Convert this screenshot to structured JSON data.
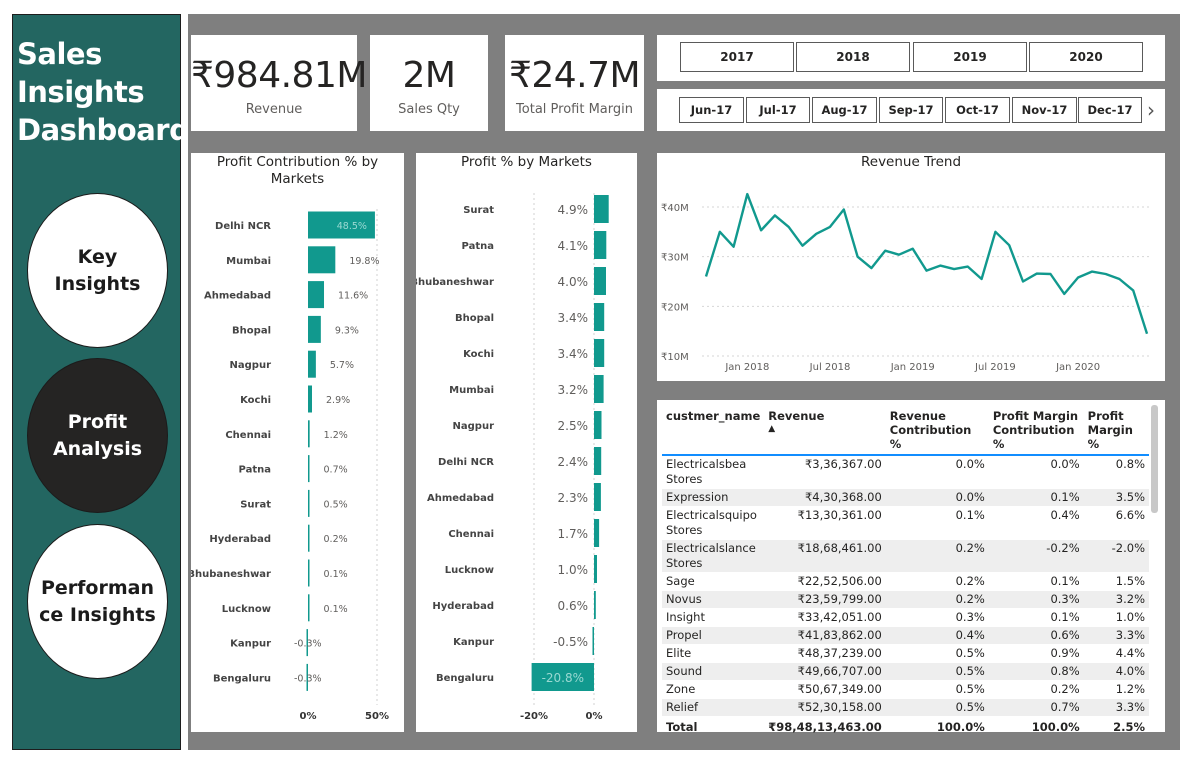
{
  "sidebar": {
    "title_lines": [
      "Sales",
      "Insights",
      "Dashboard"
    ],
    "nav": [
      {
        "label_lines": [
          "Key",
          "Insights"
        ],
        "active": false
      },
      {
        "label_lines": [
          "Profit",
          "Analysis"
        ],
        "active": true
      },
      {
        "label_lines": [
          "Performan",
          "ce Insights"
        ],
        "active": false
      }
    ]
  },
  "kpis": [
    {
      "value": "₹984.81M",
      "label": "Revenue"
    },
    {
      "value": "2M",
      "label": "Sales Qty"
    },
    {
      "value": "₹24.7M",
      "label": "Total Profit Margin"
    }
  ],
  "year_slicer": [
    "2017",
    "2018",
    "2019",
    "2020"
  ],
  "month_slicer": [
    "Jun-17",
    "Jul-17",
    "Aug-17",
    "Sep-17",
    "Oct-17",
    "Nov-17",
    "Dec-17"
  ],
  "chart_data": [
    {
      "type": "bar",
      "orientation": "horizontal",
      "title": "Profit Contribution % by Markets",
      "categories": [
        "Delhi NCR",
        "Mumbai",
        "Ahmedabad",
        "Bhopal",
        "Nagpur",
        "Kochi",
        "Chennai",
        "Patna",
        "Surat",
        "Hyderabad",
        "Bhubaneshwar",
        "Lucknow",
        "Kanpur",
        "Bengaluru"
      ],
      "values": [
        48.5,
        19.8,
        11.6,
        9.3,
        5.7,
        2.9,
        1.2,
        0.7,
        0.5,
        0.2,
        0.1,
        0.1,
        -0.3,
        -0.3
      ],
      "value_labels": [
        "48.5%",
        "19.8%",
        "11.6%",
        "9.3%",
        "5.7%",
        "2.9%",
        "1.2%",
        "0.7%",
        "0.5%",
        "0.2%",
        "0.1%",
        "0.1%",
        "-0.3%",
        "-0.3%"
      ],
      "x_ticks": [
        "0%",
        "50%"
      ],
      "xlim": [
        0,
        50
      ],
      "color": "#11998e"
    },
    {
      "type": "bar",
      "orientation": "horizontal",
      "title": "Profit % by Markets",
      "categories": [
        "Surat",
        "Patna",
        "Bhubaneshwar",
        "Bhopal",
        "Kochi",
        "Mumbai",
        "Nagpur",
        "Delhi NCR",
        "Ahmedabad",
        "Chennai",
        "Lucknow",
        "Hyderabad",
        "Kanpur",
        "Bengaluru"
      ],
      "values": [
        4.9,
        4.1,
        4.0,
        3.4,
        3.4,
        3.2,
        2.5,
        2.4,
        2.3,
        1.7,
        1.0,
        0.6,
        -0.5,
        -20.8
      ],
      "value_labels": [
        "4.9%",
        "4.1%",
        "4.0%",
        "3.4%",
        "3.4%",
        "3.2%",
        "2.5%",
        "2.4%",
        "2.3%",
        "1.7%",
        "1.0%",
        "0.6%",
        "-0.5%",
        "-20.8%"
      ],
      "x_ticks": [
        "-20%",
        "0%"
      ],
      "xlim": [
        -20.8,
        4.9
      ],
      "color": "#11998e"
    },
    {
      "type": "line",
      "title": "Revenue Trend",
      "y_ticks": [
        "₹10M",
        "₹20M",
        "₹30M",
        "₹40M"
      ],
      "ylim": [
        10,
        40
      ],
      "x_ticks": [
        "Jan 2018",
        "Jul 2018",
        "Jan 2019",
        "Jul 2019",
        "Jan 2020"
      ],
      "x": [
        "2017-10",
        "2017-11",
        "2017-12",
        "2018-01",
        "2018-02",
        "2018-03",
        "2018-04",
        "2018-05",
        "2018-06",
        "2018-07",
        "2018-08",
        "2018-09",
        "2018-10",
        "2018-11",
        "2018-12",
        "2019-01",
        "2019-02",
        "2019-03",
        "2019-04",
        "2019-05",
        "2019-06",
        "2019-07",
        "2019-08",
        "2019-09",
        "2019-10",
        "2019-11",
        "2019-12",
        "2020-01",
        "2020-02",
        "2020-03",
        "2020-04",
        "2020-05",
        "2020-06"
      ],
      "y": [
        26.0,
        35.0,
        32.0,
        42.6,
        35.3,
        38.3,
        36.0,
        32.2,
        34.6,
        36.0,
        39.5,
        30.0,
        27.7,
        31.2,
        30.4,
        31.6,
        27.2,
        28.2,
        27.5,
        28.0,
        25.5,
        35.0,
        32.3,
        25.0,
        26.6,
        26.5,
        22.5,
        25.8,
        27.0,
        26.5,
        25.5,
        23.2,
        14.5
      ],
      "grid": true,
      "color": "#11998e"
    }
  ],
  "table": {
    "columns": [
      "custmer_name",
      "Revenue",
      "Revenue Contribution %",
      "Profit Margin Contribution %",
      "Profit Margin %"
    ],
    "rows": [
      [
        "Electricalsbea Stores",
        "₹3,36,367.00",
        "0.0%",
        "0.0%",
        "0.8%"
      ],
      [
        "Expression",
        "₹4,30,368.00",
        "0.0%",
        "0.1%",
        "3.5%"
      ],
      [
        "Electricalsquipo Stores",
        "₹13,30,361.00",
        "0.1%",
        "0.4%",
        "6.6%"
      ],
      [
        "Electricalslance Stores",
        "₹18,68,461.00",
        "0.2%",
        "-0.2%",
        "-2.0%"
      ],
      [
        "Sage",
        "₹22,52,506.00",
        "0.2%",
        "0.1%",
        "1.5%"
      ],
      [
        "Novus",
        "₹23,59,799.00",
        "0.2%",
        "0.3%",
        "3.2%"
      ],
      [
        "Insight",
        "₹33,42,051.00",
        "0.3%",
        "0.1%",
        "1.0%"
      ],
      [
        "Propel",
        "₹41,83,862.00",
        "0.4%",
        "0.6%",
        "3.3%"
      ],
      [
        "Elite",
        "₹48,37,239.00",
        "0.5%",
        "0.9%",
        "4.4%"
      ],
      [
        "Sound",
        "₹49,66,707.00",
        "0.5%",
        "0.8%",
        "4.0%"
      ],
      [
        "Zone",
        "₹50,67,349.00",
        "0.5%",
        "0.2%",
        "1.2%"
      ],
      [
        "Relief",
        "₹52,30,158.00",
        "0.5%",
        "0.7%",
        "3.3%"
      ]
    ],
    "total": [
      "Total",
      "₹98,48,13,463.00",
      "100.0%",
      "100.0%",
      "2.5%"
    ]
  }
}
